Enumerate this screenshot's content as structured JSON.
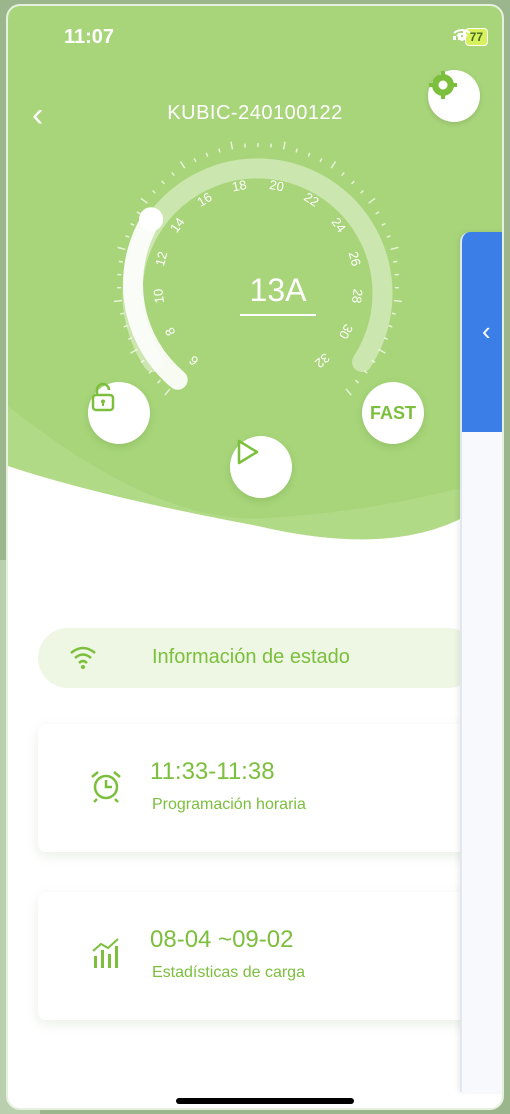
{
  "status_bar": {
    "time": "11:07",
    "battery": "77"
  },
  "header": {
    "device_id": "KUBIC-240100122"
  },
  "dial": {
    "current_label": "13A",
    "scale_labels": [
      "6",
      "8",
      "10",
      "12",
      "14",
      "16",
      "18",
      "20",
      "22",
      "24",
      "26",
      "28",
      "30",
      "32"
    ],
    "current_fraction": 0.29
  },
  "controls": {
    "fast_label": "FAST"
  },
  "status_info": {
    "label": "Información de estado"
  },
  "schedule": {
    "value": "11:33-11:38",
    "label": "Programación horaria"
  },
  "stats": {
    "value": "08-04 ~09-02",
    "label": "Estadísticas de carga"
  },
  "colors": {
    "accent": "#7bbf3c",
    "hero": "#a8d57a",
    "panel_blue": "#3b7ee8"
  },
  "icons": [
    "back-icon",
    "gear-icon",
    "unlock-icon",
    "play-icon",
    "fast-icon",
    "cloud-upload-icon",
    "wifi-icon",
    "alarm-icon",
    "chart-icon"
  ]
}
